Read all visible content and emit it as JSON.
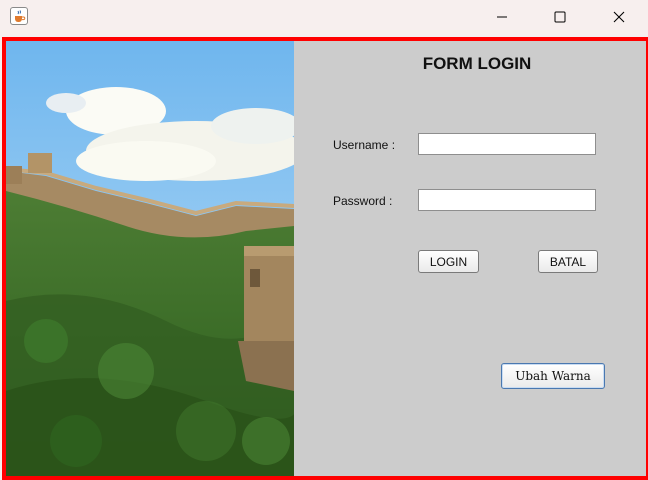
{
  "window": {
    "title": "",
    "controls": [
      "minimize",
      "maximize",
      "close"
    ]
  },
  "form": {
    "title": "FORM LOGIN",
    "username_label": "Username :",
    "username_value": "",
    "password_label": "Password :",
    "password_value": "",
    "login_button": "LOGIN",
    "cancel_button": "BATAL",
    "change_color_button": "Ubah Warna"
  },
  "colors": {
    "frame_border": "#ff0000",
    "panel_background": "#cccccc"
  },
  "icons": {
    "app": "java-cup-icon",
    "minimize": "minimize-icon",
    "maximize": "maximize-icon",
    "close": "close-icon"
  }
}
